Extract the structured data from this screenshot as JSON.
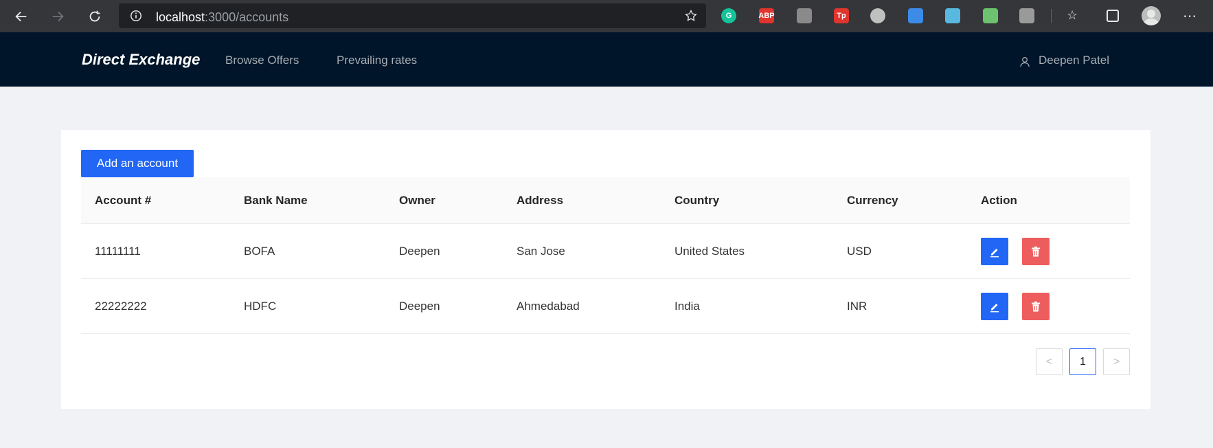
{
  "browser": {
    "url_host": "localhost",
    "url_path": ":3000/accounts",
    "icons": [
      "back-arrow-icon",
      "forward-arrow-icon",
      "reload-icon",
      "info-icon",
      "bookmark-star-icon"
    ],
    "extensions": [
      {
        "name": "grammarly-extension-icon",
        "label": "G",
        "color": "#15c39a"
      },
      {
        "name": "adblock-plus-extension-icon",
        "label": "ABP",
        "color": "#e0342e"
      },
      {
        "name": "extension-icon",
        "label": "",
        "color": "#8a8a8a"
      },
      {
        "name": "tp-extension-icon",
        "label": "Tp",
        "color": "#e0342e"
      },
      {
        "name": "target-extension-icon",
        "label": "",
        "color": "#c0c0c0"
      },
      {
        "name": "window-extension-icon",
        "label": "",
        "color": "#3c8be8"
      },
      {
        "name": "jar-extension-icon",
        "label": "",
        "color": "#58b8e0"
      },
      {
        "name": "pen-extension-icon",
        "label": "",
        "color": "#6dc36d"
      },
      {
        "name": "copy-extension-icon",
        "label": "",
        "color": "#9a9a9a"
      }
    ],
    "more_label": "⋯"
  },
  "header": {
    "brand": "Direct Exchange",
    "nav": [
      "Browse Offers",
      "Prevailing rates"
    ],
    "user_name": "Deepen Patel",
    "colors": {
      "background": "#001529",
      "link": "#a6adb4"
    }
  },
  "main": {
    "add_button_label": "Add an account",
    "columns": [
      "Account #",
      "Bank Name",
      "Owner",
      "Address",
      "Country",
      "Currency",
      "Action"
    ],
    "rows": [
      {
        "account": "11111111",
        "bank": "BOFA",
        "owner": "Deepen",
        "address": "San Jose",
        "country": "United States",
        "currency": "USD"
      },
      {
        "account": "22222222",
        "bank": "HDFC",
        "owner": "Deepen",
        "address": "Ahmedabad",
        "country": "India",
        "currency": "INR"
      }
    ],
    "pagination": {
      "prev": "<",
      "current_page": "1",
      "next": ">"
    },
    "colors": {
      "primary": "#2166f5",
      "danger": "#ee5d5d"
    }
  }
}
